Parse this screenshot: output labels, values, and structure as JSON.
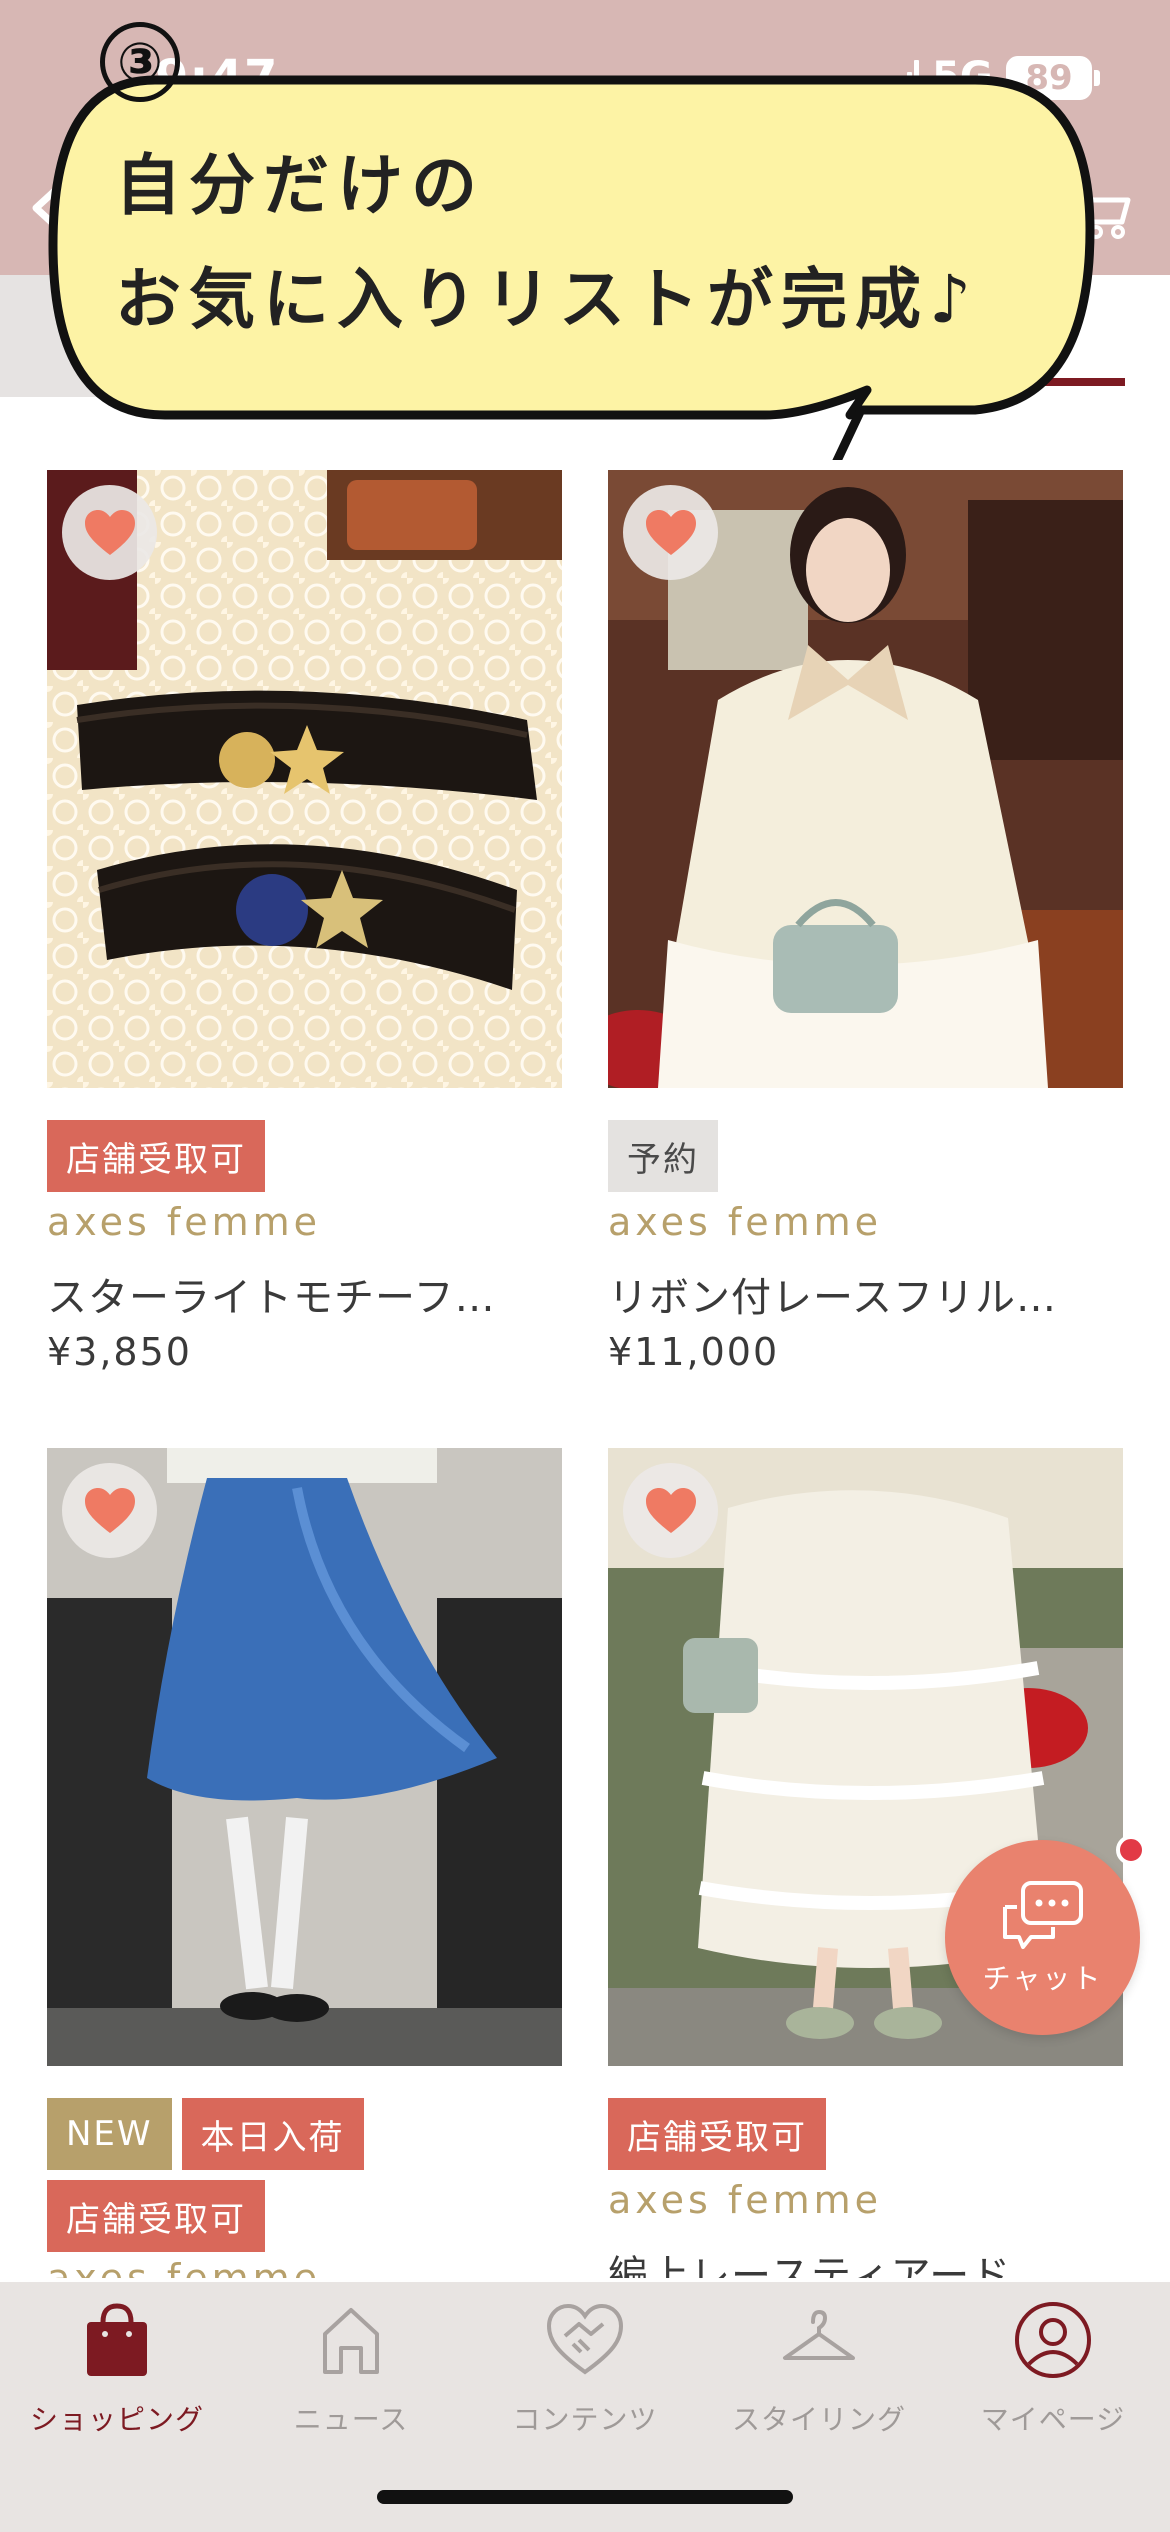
{
  "status_bar": {
    "time": "9:47",
    "network": "5G",
    "battery": "89"
  },
  "callout": {
    "step": "③",
    "line1": "自分だけの",
    "line2": "お気に入りリストが完成♪"
  },
  "products": [
    {
      "badges": [
        {
          "label": "店舗受取可",
          "kind": "store"
        }
      ],
      "brand": "axes femme",
      "name": "スターライトモチーフ…",
      "price": "¥3,850"
    },
    {
      "badges": [
        {
          "label": "予約",
          "kind": "reserve"
        }
      ],
      "brand": "axes femme",
      "name": "リボン付レースフリル…",
      "price": "¥11,000"
    },
    {
      "badges": [
        {
          "label": "NEW",
          "kind": "new"
        },
        {
          "label": "本日入荷",
          "kind": "store"
        },
        {
          "label": "店舗受取可",
          "kind": "store"
        }
      ],
      "brand": "axes femme",
      "name": "",
      "price": ""
    },
    {
      "badges": [
        {
          "label": "店舗受取可",
          "kind": "store"
        }
      ],
      "brand": "axes femme",
      "name": "編上レースティアード…",
      "price": ""
    }
  ],
  "chat": {
    "label": "チャット"
  },
  "tabs": [
    {
      "label": "ショッピング",
      "icon": "shopping-bag-icon",
      "active": true
    },
    {
      "label": "ニュース",
      "icon": "home-icon",
      "active": false
    },
    {
      "label": "コンテンツ",
      "icon": "heart-handshake-icon",
      "active": false
    },
    {
      "label": "スタイリング",
      "icon": "hanger-icon",
      "active": false
    },
    {
      "label": "マイページ",
      "icon": "user-icon",
      "active": false
    }
  ],
  "colors": {
    "header": "#d7b7b4",
    "accent": "#7d1a22",
    "badge_store": "#d9685a",
    "brand": "#b7a06b",
    "favorite": "#ef7a63",
    "callout_fill": "#fdf3a5"
  }
}
